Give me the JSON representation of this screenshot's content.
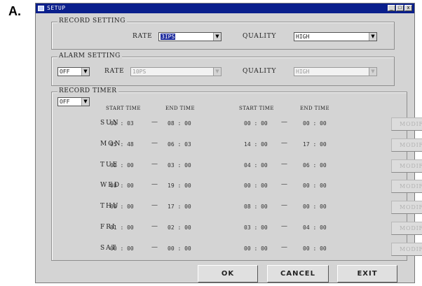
{
  "figure_label": "A.",
  "window": {
    "title": "SETUP",
    "controls": {
      "minimize": "_",
      "maximize": "□",
      "close": "x"
    }
  },
  "record_setting": {
    "title": "RECORD SETTING",
    "rate_label": "RATE",
    "rate_value": "3IPS",
    "quality_label": "QUALITY",
    "quality_value": "HIGH"
  },
  "alarm_setting": {
    "title": "ALARM SETTING",
    "mode_value": "OFF",
    "rate_label": "RATE",
    "rate_value": "10PS",
    "quality_label": "QUALITY",
    "quality_value": "HIGH"
  },
  "record_timer": {
    "title": "RECORD TIMER",
    "mode_value": "OFF",
    "headers": [
      "START TIME",
      "END TIME",
      "START TIME",
      "END TIME"
    ],
    "dash": "—",
    "modify_label": "MODIFY",
    "rows": [
      {
        "day": "SUN",
        "s1": "01 : 03",
        "e1": "08 : 00",
        "s2": "00 : 00",
        "e2": "00 : 00"
      },
      {
        "day": "MON",
        "s1": "05 : 48",
        "e1": "06 : 03",
        "s2": "14 : 00",
        "e2": "17 : 00"
      },
      {
        "day": "TUE",
        "s1": "02 : 00",
        "e1": "03 : 00",
        "s2": "04 : 00",
        "e2": "06 : 00"
      },
      {
        "day": "WED",
        "s1": "08 : 00",
        "e1": "19 : 00",
        "s2": "00 : 00",
        "e2": "00 : 00"
      },
      {
        "day": "THU",
        "s1": "08 : 00",
        "e1": "17 : 00",
        "s2": "08 : 00",
        "e2": "00 : 00"
      },
      {
        "day": "FRI",
        "s1": "01 : 00",
        "e1": "02 : 00",
        "s2": "03 : 00",
        "e2": "04 : 00"
      },
      {
        "day": "SAT",
        "s1": "00 : 00",
        "e1": "00 : 00",
        "s2": "00 : 00",
        "e2": "00 : 00"
      }
    ]
  },
  "buttons": {
    "ok": "OK",
    "cancel": "CANCEL",
    "exit": "EXIT"
  },
  "colors": {
    "title_bar": "#0a1f8c",
    "selection": "#1c2a9c",
    "window_bg": "#d4d4d4"
  }
}
